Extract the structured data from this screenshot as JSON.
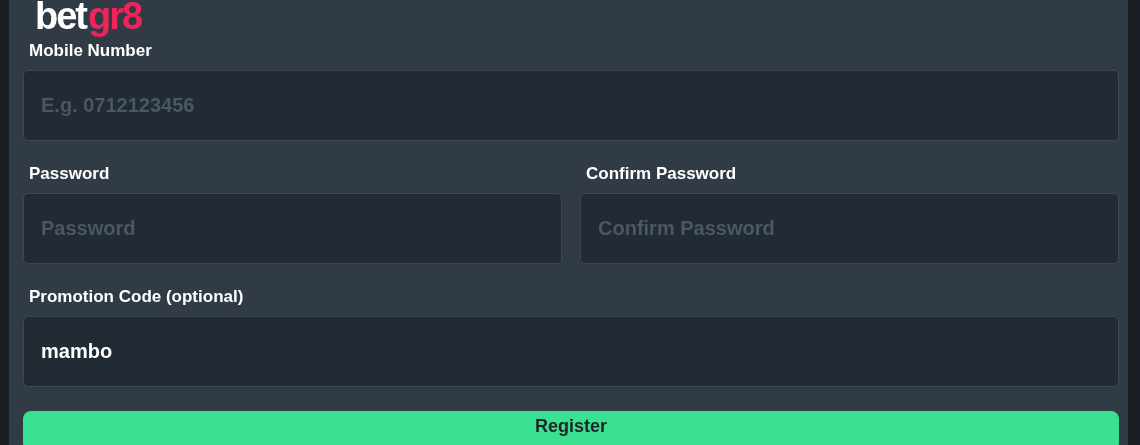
{
  "logo": {
    "part_1": "bet",
    "part_2": "gr8"
  },
  "field_rows": [
    [
      {
        "label": "Mobile Number",
        "placeholder": "E.g. 0712123456"
      }
    ],
    [
      {
        "label": "Password",
        "placeholder": "Password"
      },
      {
        "label": "Confirm Password",
        "placeholder": "Confirm Password"
      }
    ],
    [
      {
        "label": "Promotion Code (optional)",
        "value": "mambo"
      }
    ]
  ],
  "submit": {
    "label": "Register"
  }
}
